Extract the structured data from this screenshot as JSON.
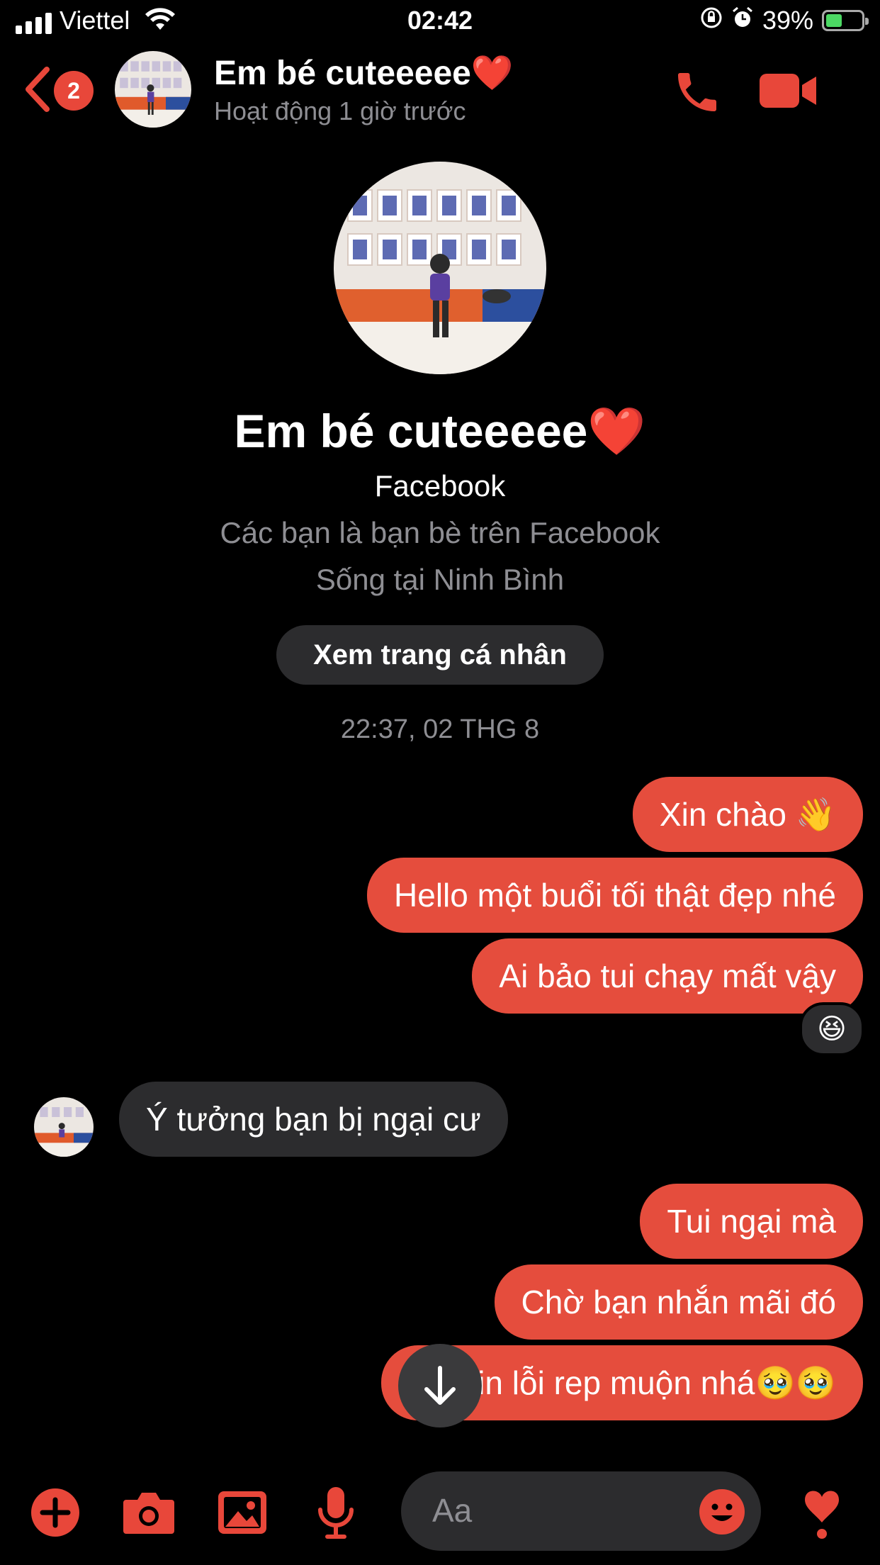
{
  "status_bar": {
    "carrier": "Viettel",
    "time": "02:42",
    "battery": "39%"
  },
  "header": {
    "unread_count": "2",
    "name": "Em bé cuteeeee❤️",
    "activity": "Hoạt động 1 giờ trước"
  },
  "profile": {
    "name": "Em bé cuteeeee❤️",
    "platform": "Facebook",
    "friends_text": "Các bạn là bạn bè trên Facebook",
    "location": "Sống tại Ninh Bình",
    "view_profile_label": "Xem trang cá nhân"
  },
  "conversation": {
    "timestamp": "22:37, 02 THG 8",
    "messages": [
      {
        "direction": "outgoing",
        "text": "Xin chào 👋"
      },
      {
        "direction": "outgoing",
        "text": "Hello một buổi tối thật đẹp nhé"
      },
      {
        "direction": "outgoing",
        "text": "Ai bảo tui chạy mất vậy",
        "reaction": "😆"
      },
      {
        "direction": "incoming",
        "text": "Ý tưởng bạn bị ngại cư"
      },
      {
        "direction": "outgoing",
        "text": "Tui ngại mà"
      },
      {
        "direction": "outgoing",
        "text": "Chờ bạn nhắn mãi đó"
      },
      {
        "direction": "outgoing",
        "text": "Tui xin lỗi rep muộn nhá🥹🥹"
      }
    ]
  },
  "composer": {
    "placeholder": "Aa"
  },
  "colors": {
    "accent": "#e8473a",
    "outgoing_bubble": "#e54d3d",
    "incoming_bubble": "#2c2c2e",
    "background": "#000000"
  },
  "icons": [
    "chevron-left-icon",
    "phone-icon",
    "video-camera-icon",
    "arrow-down-icon",
    "plus-icon",
    "camera-icon",
    "image-icon",
    "microphone-icon",
    "emoji-icon",
    "heart-icon"
  ]
}
